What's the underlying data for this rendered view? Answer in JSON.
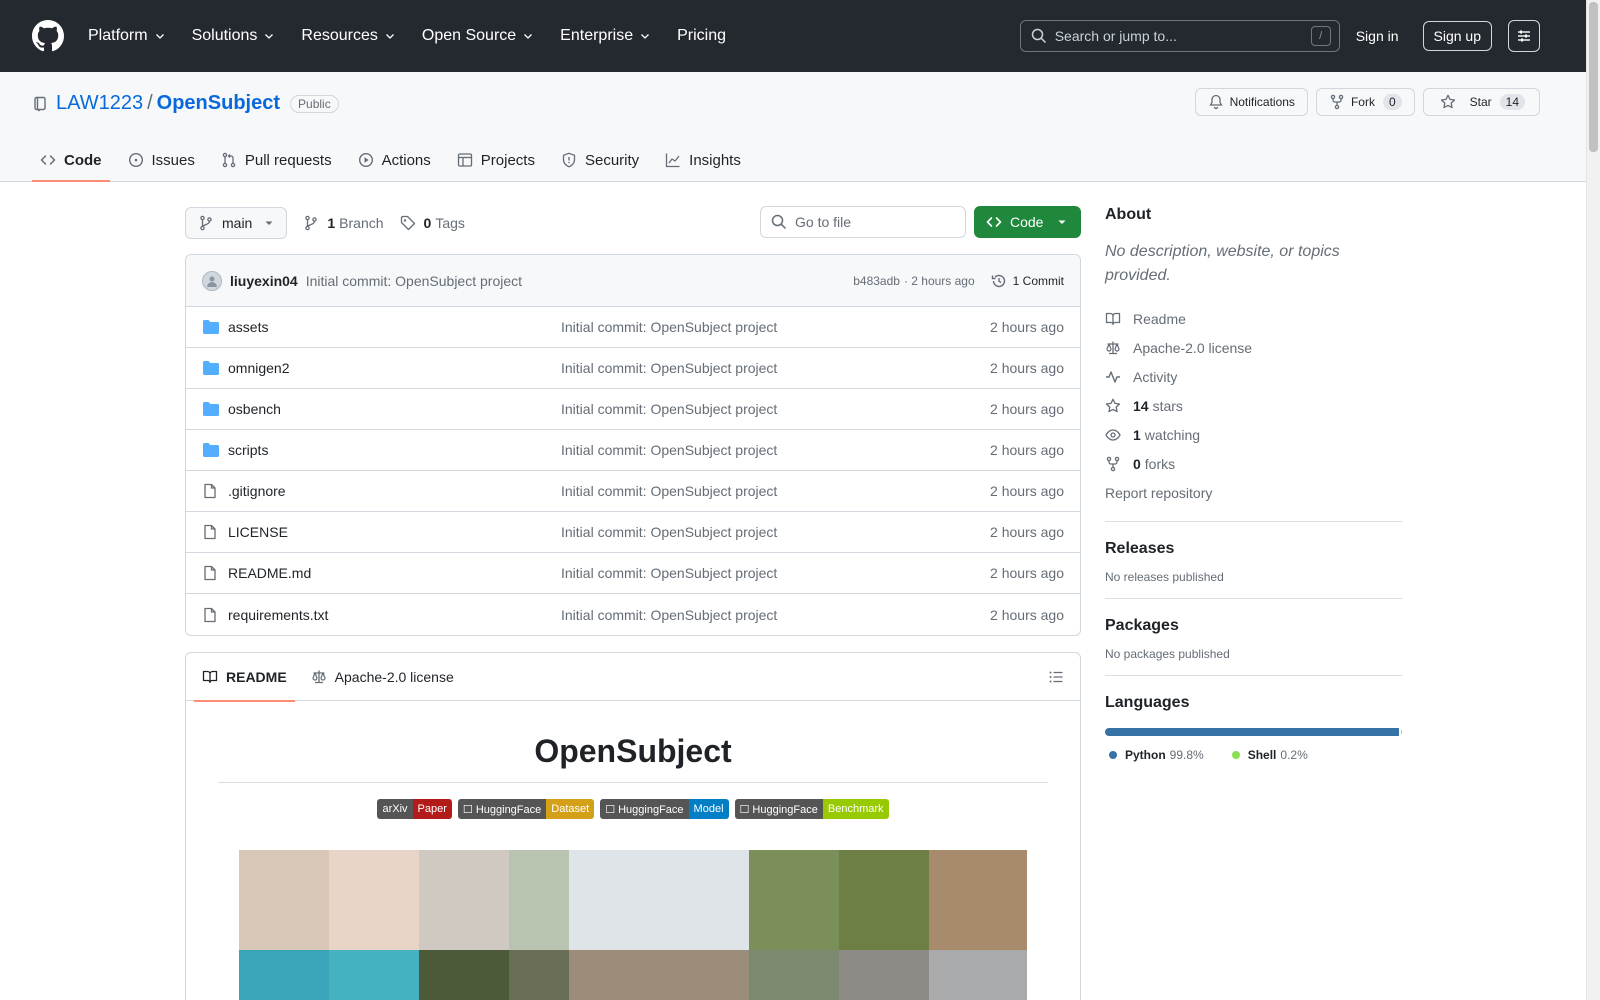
{
  "header": {
    "nav": [
      {
        "label": "Platform",
        "has_menu": true
      },
      {
        "label": "Solutions",
        "has_menu": true
      },
      {
        "label": "Resources",
        "has_menu": true
      },
      {
        "label": "Open Source",
        "has_menu": true
      },
      {
        "label": "Enterprise",
        "has_menu": true
      },
      {
        "label": "Pricing",
        "has_menu": false
      }
    ],
    "search_placeholder": "Search or jump to...",
    "search_key": "/",
    "sign_in": "Sign in",
    "sign_up": "Sign up"
  },
  "repo": {
    "owner": "LAW1223",
    "separator": "/",
    "name": "OpenSubject",
    "visibility": "Public",
    "notifications_label": "Notifications",
    "fork_label": "Fork",
    "fork_count": "0",
    "star_label": "Star",
    "star_count": "14",
    "tabs": [
      {
        "label": "Code",
        "icon": "code-icon",
        "active": true
      },
      {
        "label": "Issues",
        "icon": "issue-icon",
        "active": false
      },
      {
        "label": "Pull requests",
        "icon": "pull-request-icon",
        "active": false
      },
      {
        "label": "Actions",
        "icon": "play-icon",
        "active": false
      },
      {
        "label": "Projects",
        "icon": "table-icon",
        "active": false
      },
      {
        "label": "Security",
        "icon": "shield-icon",
        "active": false
      },
      {
        "label": "Insights",
        "icon": "graph-icon",
        "active": false
      }
    ]
  },
  "toolbar": {
    "branch": "main",
    "branch_count": "1",
    "branch_label": "Branch",
    "tag_count": "0",
    "tag_label": "Tags",
    "goto_placeholder": "Go to file",
    "code_label": "Code"
  },
  "commit": {
    "author": "liuyexin04",
    "message": "Initial commit: OpenSubject project",
    "sha": "b483adb",
    "time": "· 2 hours ago",
    "commits_label": "1 Commit"
  },
  "files": [
    {
      "name": "assets",
      "type": "folder",
      "message": "Initial commit: OpenSubject project",
      "time": "2 hours ago"
    },
    {
      "name": "omnigen2",
      "type": "folder",
      "message": "Initial commit: OpenSubject project",
      "time": "2 hours ago"
    },
    {
      "name": "osbench",
      "type": "folder",
      "message": "Initial commit: OpenSubject project",
      "time": "2 hours ago"
    },
    {
      "name": "scripts",
      "type": "folder",
      "message": "Initial commit: OpenSubject project",
      "time": "2 hours ago"
    },
    {
      "name": ".gitignore",
      "type": "file",
      "message": "Initial commit: OpenSubject project",
      "time": "2 hours ago"
    },
    {
      "name": "LICENSE",
      "type": "file",
      "message": "Initial commit: OpenSubject project",
      "time": "2 hours ago"
    },
    {
      "name": "README.md",
      "type": "file",
      "message": "Initial commit: OpenSubject project",
      "time": "2 hours ago"
    },
    {
      "name": "requirements.txt",
      "type": "file",
      "message": "Initial commit: OpenSubject project",
      "time": "2 hours ago"
    }
  ],
  "readme": {
    "tab_readme": "README",
    "tab_license": "Apache-2.0 license",
    "title": "OpenSubject",
    "badges": [
      {
        "left": "arXiv",
        "right": "Paper",
        "color": "#b31b1b"
      },
      {
        "left": "☐ HuggingFace",
        "right": "Dataset",
        "color": "#d4a017"
      },
      {
        "left": "☐ HuggingFace",
        "right": "Model",
        "color": "#007ec6"
      },
      {
        "left": "☐ HuggingFace",
        "right": "Benchmark",
        "color": "#97ca00"
      }
    ]
  },
  "about": {
    "heading": "About",
    "description": "No description, website, or topics provided.",
    "readme": "Readme",
    "license": "Apache-2.0 license",
    "activity": "Activity",
    "stars_count": "14",
    "stars_label": "stars",
    "watching_count": "1",
    "watching_label": "watching",
    "forks_count": "0",
    "forks_label": "forks",
    "report": "Report repository"
  },
  "releases": {
    "heading": "Releases",
    "text": "No releases published"
  },
  "packages": {
    "heading": "Packages",
    "text": "No packages published"
  },
  "languages": {
    "heading": "Languages",
    "items": [
      {
        "name": "Python",
        "pct": "99.8%",
        "value": 99.8,
        "color": "#3572A5"
      },
      {
        "name": "Shell",
        "pct": "0.2%",
        "value": 0.2,
        "color": "#89e051"
      }
    ]
  }
}
